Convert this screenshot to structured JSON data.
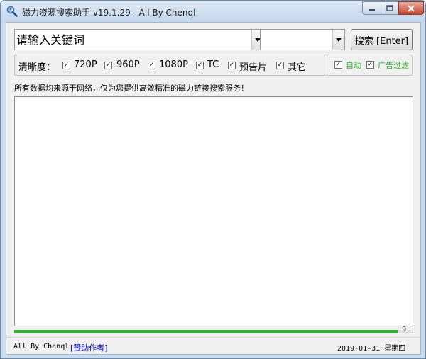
{
  "window": {
    "title": "磁力资源搜索助手 v19.1.29 - All By Chenql",
    "icon": "magnifier-user-icon",
    "controls": [
      "minimize-icon",
      "maximize-icon",
      "close-icon"
    ]
  },
  "search": {
    "keyword_placeholder": "请输入关键词",
    "keyword_value": "",
    "source_selected": "",
    "button_label": "搜索 [Enter]"
  },
  "filters": {
    "label": "清晰度：",
    "options": [
      {
        "label": "720P",
        "checked": true
      },
      {
        "label": "960P",
        "checked": true
      },
      {
        "label": "1080P",
        "checked": true
      },
      {
        "label": "TC",
        "checked": true
      },
      {
        "label": "预告片",
        "checked": true
      },
      {
        "label": "其它",
        "checked": true
      }
    ]
  },
  "options": {
    "auto": {
      "label": "自动",
      "checked": true
    },
    "ad_filter": {
      "label": "广告过滤",
      "checked": true
    }
  },
  "notice": "所有数据均来源于网络，仅为您提供高效精准的磁力链接搜索服务！",
  "progress": {
    "fraction": 0.96,
    "text": "9.."
  },
  "status": {
    "author": "All By Chenql",
    "donate_link": "[赞助作者]",
    "datetime": "2019-01-31 星期四"
  },
  "colors": {
    "accent_green": "#2bb12b",
    "link_blue": "#0000cc",
    "title_bar": "#c9dcef"
  }
}
